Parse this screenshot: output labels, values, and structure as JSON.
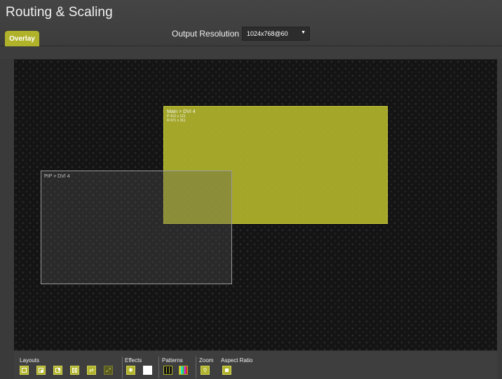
{
  "header": {
    "title": "Routing & Scaling"
  },
  "tabs": [
    {
      "label": "Overlay",
      "active": true
    }
  ],
  "output_resolution": {
    "label": "Output Resolution",
    "selected": "1024x768@60"
  },
  "canvas": {
    "main_window": {
      "title": "Main > DVI 4",
      "position_text": "P:312 x 121",
      "resolution_text": "R:471 x 311"
    },
    "pip_window": {
      "title": "PIP > DVI 4"
    }
  },
  "toolbar": {
    "layouts_label": "Layouts",
    "effects_label": "Effects",
    "patterns_label": "Patterns",
    "zoom_label": "Zoom",
    "aspect_ratio_label": "Aspect Ratio",
    "layout_buttons": [
      "layout-single-icon",
      "layout-pip-corner-icon",
      "layout-pip-right-icon",
      "layout-side-by-side-icon",
      "layout-swap-icon",
      "layout-custom-icon"
    ],
    "effect_buttons": [
      "effect-snowflake-icon",
      "effect-white-box-icon"
    ],
    "pattern_buttons": [
      "pattern-bars-icon",
      "pattern-color-bars-icon"
    ],
    "zoom_buttons": [
      "zoom-magnifier-icon"
    ],
    "aspect_buttons": [
      "aspect-ratio-icon"
    ]
  },
  "colors": {
    "accent": "#b0b32a",
    "background": "#3a3a3a",
    "canvas": "#141414"
  }
}
